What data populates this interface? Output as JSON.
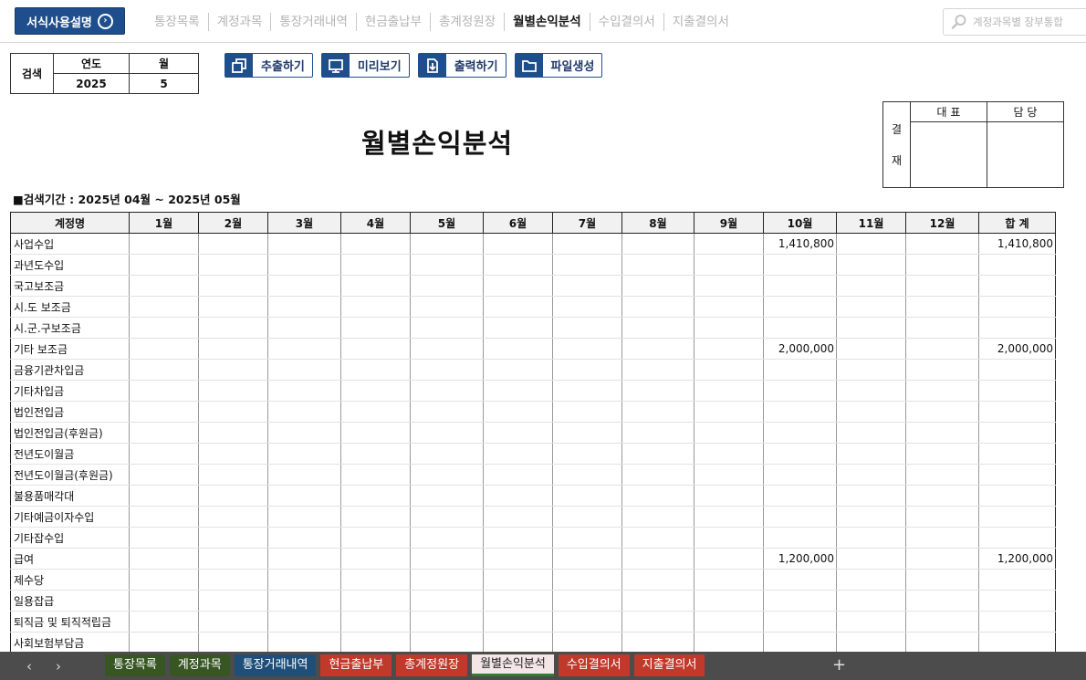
{
  "header": {
    "guide_button": "서식사용설명",
    "nav_tabs": [
      "통장목록",
      "계정과목",
      "통장거래내역",
      "현금출납부",
      "총계정원장",
      "월별손익분석",
      "수입결의서",
      "지출결의서"
    ],
    "active_tab": 5,
    "search_placeholder": "계정과목별 장부통합"
  },
  "search": {
    "label": "검색",
    "year_header": "연도",
    "month_header": "월",
    "year_value": "2025",
    "month_value": "5"
  },
  "actions": [
    {
      "label": "추출하기",
      "icon": "copy-icon"
    },
    {
      "label": "미리보기",
      "icon": "monitor-icon"
    },
    {
      "label": "출력하기",
      "icon": "print-icon"
    },
    {
      "label": "파일생성",
      "icon": "folder-icon"
    }
  ],
  "document": {
    "title": "월별손익분석",
    "period": "■검색기간 : 2025년  04월  ~  2025년  05월"
  },
  "approval": {
    "side_label_top": "결",
    "side_label_bottom": "재",
    "col1": "대 표",
    "col2": "담 당"
  },
  "table": {
    "headers": [
      "계정명",
      "1월",
      "2월",
      "3월",
      "4월",
      "5월",
      "6월",
      "7월",
      "8월",
      "9월",
      "10월",
      "11월",
      "12월",
      "합 계"
    ],
    "rows": [
      {
        "name": "사업수입",
        "values": [
          "",
          "",
          "",
          "",
          "",
          "",
          "",
          "",
          "",
          "1,410,800",
          "",
          "",
          "1,410,800"
        ]
      },
      {
        "name": "과년도수입",
        "values": [
          "",
          "",
          "",
          "",
          "",
          "",
          "",
          "",
          "",
          "",
          "",
          "",
          ""
        ]
      },
      {
        "name": "국고보조금",
        "values": [
          "",
          "",
          "",
          "",
          "",
          "",
          "",
          "",
          "",
          "",
          "",
          "",
          ""
        ]
      },
      {
        "name": "시.도 보조금",
        "values": [
          "",
          "",
          "",
          "",
          "",
          "",
          "",
          "",
          "",
          "",
          "",
          "",
          ""
        ]
      },
      {
        "name": "시.군.구보조금",
        "values": [
          "",
          "",
          "",
          "",
          "",
          "",
          "",
          "",
          "",
          "",
          "",
          "",
          ""
        ]
      },
      {
        "name": "기타 보조금",
        "values": [
          "",
          "",
          "",
          "",
          "",
          "",
          "",
          "",
          "",
          "2,000,000",
          "",
          "",
          "2,000,000"
        ]
      },
      {
        "name": "금융기관차입금",
        "values": [
          "",
          "",
          "",
          "",
          "",
          "",
          "",
          "",
          "",
          "",
          "",
          "",
          ""
        ]
      },
      {
        "name": "기타차입금",
        "values": [
          "",
          "",
          "",
          "",
          "",
          "",
          "",
          "",
          "",
          "",
          "",
          "",
          ""
        ]
      },
      {
        "name": "법인전입금",
        "values": [
          "",
          "",
          "",
          "",
          "",
          "",
          "",
          "",
          "",
          "",
          "",
          "",
          ""
        ]
      },
      {
        "name": "법인전입금(후원금)",
        "values": [
          "",
          "",
          "",
          "",
          "",
          "",
          "",
          "",
          "",
          "",
          "",
          "",
          ""
        ]
      },
      {
        "name": "전년도이월금",
        "values": [
          "",
          "",
          "",
          "",
          "",
          "",
          "",
          "",
          "",
          "",
          "",
          "",
          ""
        ]
      },
      {
        "name": "전년도이월금(후원금)",
        "values": [
          "",
          "",
          "",
          "",
          "",
          "",
          "",
          "",
          "",
          "",
          "",
          "",
          ""
        ]
      },
      {
        "name": "불용품매각대",
        "values": [
          "",
          "",
          "",
          "",
          "",
          "",
          "",
          "",
          "",
          "",
          "",
          "",
          ""
        ]
      },
      {
        "name": "기타예금이자수입",
        "values": [
          "",
          "",
          "",
          "",
          "",
          "",
          "",
          "",
          "",
          "",
          "",
          "",
          ""
        ]
      },
      {
        "name": "기타잡수입",
        "values": [
          "",
          "",
          "",
          "",
          "",
          "",
          "",
          "",
          "",
          "",
          "",
          "",
          ""
        ]
      },
      {
        "name": "급여",
        "values": [
          "",
          "",
          "",
          "",
          "",
          "",
          "",
          "",
          "",
          "1,200,000",
          "",
          "",
          "1,200,000"
        ]
      },
      {
        "name": "제수당",
        "values": [
          "",
          "",
          "",
          "",
          "",
          "",
          "",
          "",
          "",
          "",
          "",
          "",
          ""
        ]
      },
      {
        "name": "일용잡급",
        "values": [
          "",
          "",
          "",
          "",
          "",
          "",
          "",
          "",
          "",
          "",
          "",
          "",
          ""
        ]
      },
      {
        "name": "퇴직금 및 퇴직적립금",
        "values": [
          "",
          "",
          "",
          "",
          "",
          "",
          "",
          "",
          "",
          "",
          "",
          "",
          ""
        ]
      },
      {
        "name": "사회보험부담금",
        "values": [
          "",
          "",
          "",
          "",
          "",
          "",
          "",
          "",
          "",
          "",
          "",
          "",
          ""
        ]
      }
    ]
  },
  "sheet_tabs": [
    {
      "label": "통장목록",
      "color": "#375623"
    },
    {
      "label": "계정과목",
      "color": "#375623"
    },
    {
      "label": "통장거래내역",
      "color": "#1f4e79"
    },
    {
      "label": "현금출납부",
      "color": "#c0392b"
    },
    {
      "label": "총계정원장",
      "color": "#c0392b"
    },
    {
      "label": "월별손익분석",
      "color": "#f4e6e6"
    },
    {
      "label": "수입결의서",
      "color": "#c0392b"
    },
    {
      "label": "지출결의서",
      "color": "#c0392b"
    }
  ],
  "active_sheet": 5,
  "sheet_nav": {
    "prev": "‹",
    "next": "›",
    "add": "+"
  }
}
